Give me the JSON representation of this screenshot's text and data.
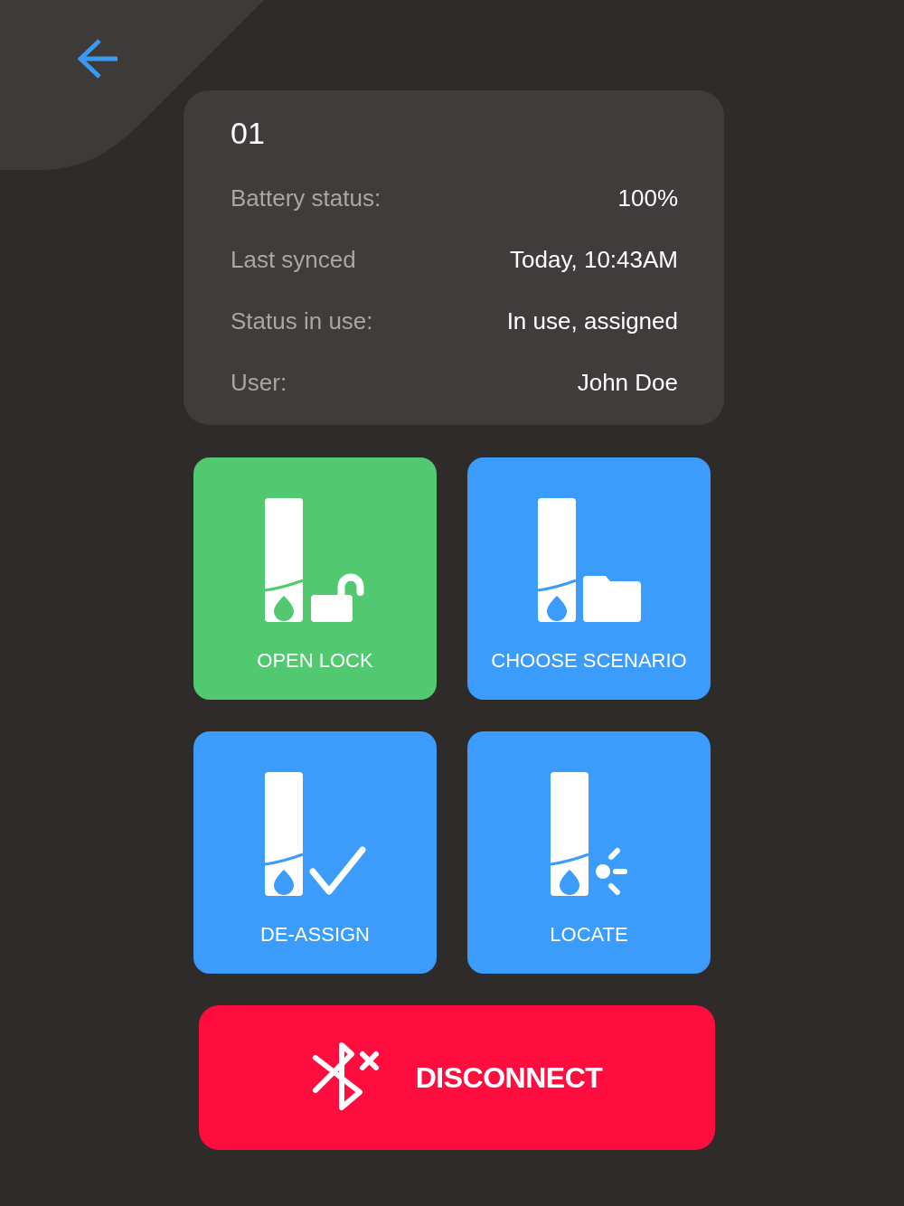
{
  "device": {
    "title": "01",
    "fields": [
      {
        "label": "Battery status:",
        "value": "100%"
      },
      {
        "label": "Last synced",
        "value": "Today, 10:43AM"
      },
      {
        "label": "Status in use:",
        "value": "In use, assigned"
      },
      {
        "label": "User:",
        "value": "John Doe"
      }
    ]
  },
  "actions": [
    {
      "kind": "unlock",
      "label": "OPEN LOCK",
      "color": "#52c970"
    },
    {
      "kind": "scenario",
      "label": "CHOOSE SCENARIO",
      "color": "#3b9cfc"
    },
    {
      "kind": "deassign",
      "label": "DE-ASSIGN",
      "color": "#3b9cfc"
    },
    {
      "kind": "locate",
      "label": "LOCATE",
      "color": "#3b9cfc"
    }
  ],
  "disconnect": {
    "label": "DISCONNECT"
  }
}
